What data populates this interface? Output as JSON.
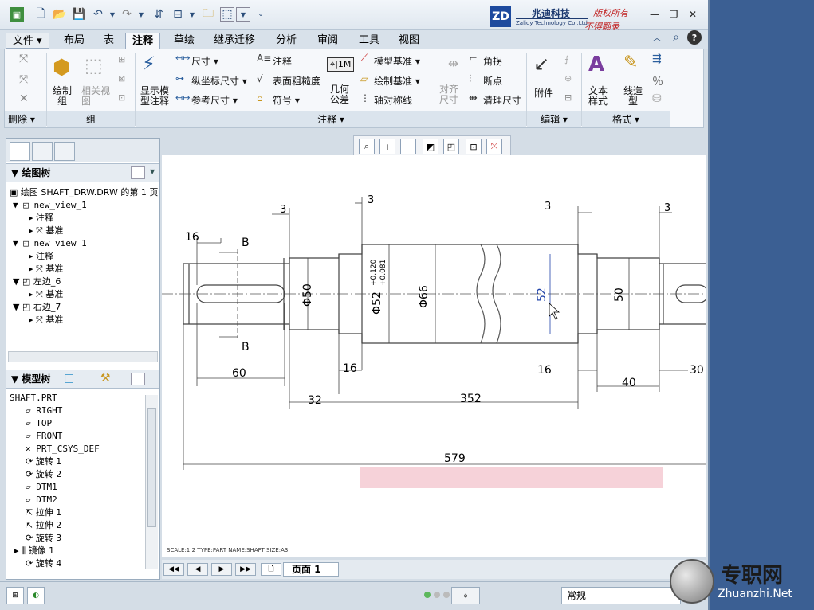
{
  "window": {
    "title_logo": {
      "mark": "ZD",
      "name_cn": "兆迪科技",
      "name_en": "Zalidy Technology Co.,Ltd."
    },
    "copyright": [
      "版权所有",
      "不得翻录"
    ]
  },
  "menu": {
    "tabs": [
      "文件",
      "布局",
      "表",
      "注释",
      "草绘",
      "继承迁移",
      "分析",
      "审阅",
      "工具",
      "视图"
    ],
    "active": "注释"
  },
  "ribbon": {
    "groups": {
      "delete": "删除",
      "group": "组",
      "annotate": "注释",
      "edit": "编辑",
      "format": "格式"
    },
    "buttons": {
      "draw_group": "绘制\n组",
      "related_view": "相关视\n图",
      "show_model_annot": "显示模\n型注释",
      "dimension": "尺寸",
      "ordinate_dim": "纵坐标尺寸",
      "ref_dim": "参考尺寸",
      "note": "注释",
      "surface_finish": "表面粗糙度",
      "symbol": "符号",
      "geom_tol": "几何\n公差",
      "model_datum": "模型基准",
      "draw_datum": "绘制基准",
      "axis_sym": "轴对称线",
      "align_dim": "对齐\n尺寸",
      "corner": "角拐",
      "break": "断点",
      "clean_dim": "清理尺寸",
      "attach": "附件",
      "text_style": "文本\n样式",
      "line_style": "线造\n型"
    }
  },
  "drawing_tree": {
    "header": "绘图树",
    "root": "绘图 SHAFT_DRW.DRW 的第 1 页",
    "items": [
      {
        "label": "new_view_1",
        "children": [
          "注释",
          "基准"
        ]
      },
      {
        "label": "new_view_1",
        "children": [
          "注释",
          "基准"
        ]
      },
      {
        "label": "左边_6",
        "children": [
          "基准"
        ]
      },
      {
        "label": "右边_7",
        "children": [
          "基准"
        ]
      }
    ]
  },
  "model_tree": {
    "header": "模型树",
    "root": "SHAFT.PRT",
    "items": [
      "RIGHT",
      "TOP",
      "FRONT",
      "PRT_CSYS_DEF",
      "旋转 1",
      "旋转 2",
      "DTM1",
      "DTM2",
      "拉伸 1",
      "拉伸 2",
      "旋转 3",
      "镜像 1",
      "旋转 4"
    ]
  },
  "drawing": {
    "dims": {
      "d3a": "3",
      "d3b": "3",
      "d3c": "3",
      "d3d": "3",
      "d16top": "16",
      "secB1": "B",
      "secB2": "B",
      "dia50": "Φ50",
      "dia52": "Φ52",
      "tol_up": "+0.120",
      "tol_lo": "+0.081",
      "dia66": "Φ66",
      "d52": "52",
      "d50": "50",
      "d60": "60",
      "d16a": "16",
      "d16b": "16",
      "d32": "32",
      "d352": "352",
      "d40": "40",
      "d30": "30",
      "d579": "579"
    },
    "stamp": "SCALE:1:2    TYPE:PART    NAME:SHAFT    SIZE:A3"
  },
  "page_bar": {
    "label": "页面 1"
  },
  "status": {
    "selection_filter": "常规"
  },
  "watermark": {
    "cn": "专职网",
    "en": "Zhuanzhi.Net"
  }
}
